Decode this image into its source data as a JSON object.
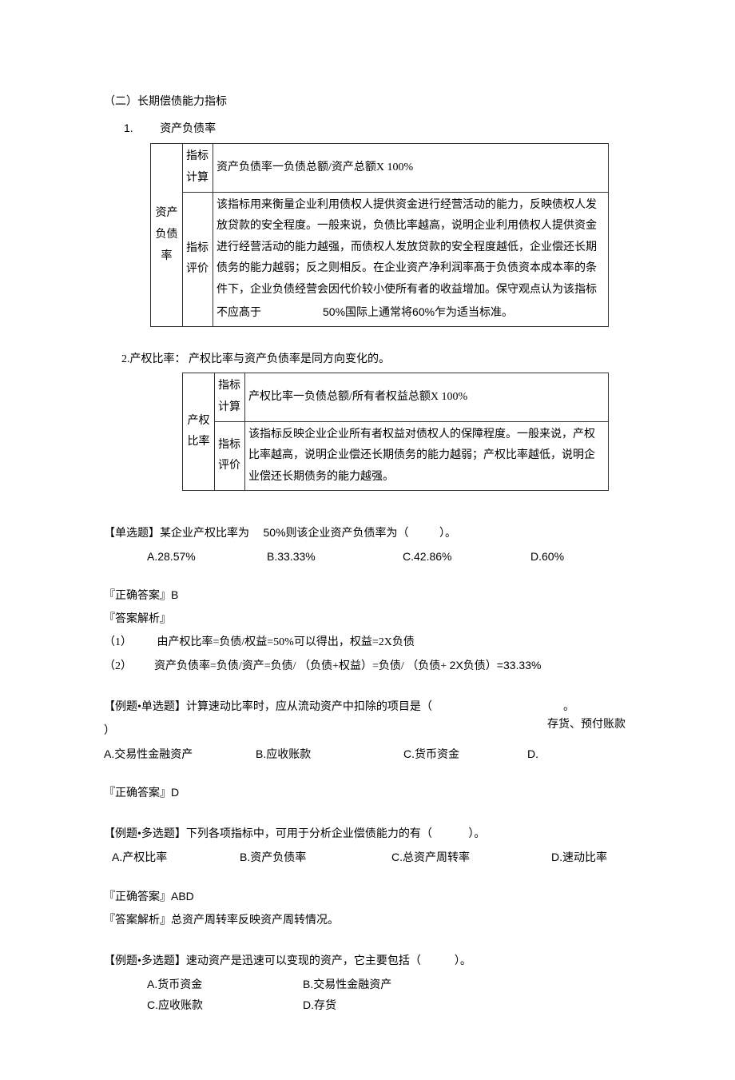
{
  "section": {
    "heading": "（二）长期偿债能力指标",
    "item1": {
      "num": "1.",
      "title": "资产负债率"
    },
    "item2_intro": "2.产权比率： 产权比率与资产负债率是同方向变化的。"
  },
  "table1": {
    "rowlabel": "资产负债率",
    "rows": [
      {
        "label": "指标计算",
        "content": "资产负债率一负债总额/资产总额X 100%"
      },
      {
        "label": "指标评价",
        "content_pre": "该指标用来衡量企业利用债权人提供资金进行经营活动的能力，反映债权人发放贷款的安全程度。一般来说，负债比率越高，说明企业利用债权人提供资金进行经营活动的能力越强，而债权人发放贷款的安全程度越低，企业偿还长期债务的能力越弱；反之则相反。在企业资产净利润率髙于负债资本成本率的条件下，企业负债经营会因代价较小使所有者的收益增加。保守观点认为该指标不应髙于",
        "pct": "50%",
        "content_mid": "国际上通常将",
        "pct2": "60%",
        "content_post": "乍为适当标准。"
      }
    ]
  },
  "table2": {
    "rowlabel": "产权比率",
    "rows": [
      {
        "label": "指标计算",
        "content": "产权比率一负债总额/所有者权益总额X 100%"
      },
      {
        "label": "指标评价",
        "content": "该指标反映企业企业所有者权益对债权人的保障程度。一般来说，产权比率越高，说明企业偿还长期债务的能力越弱；产权比率越低，说明企业偿还长期债务的能力越强。"
      }
    ]
  },
  "q1": {
    "stem_pre": "【单选题】某企业产权比率为",
    "pct": "50%",
    "stem_post": "则该企业资产负债率为（",
    "stem_end": "）。",
    "opts": {
      "a": "A.28.57%",
      "b": "B.33.33%",
      "c": "C.42.86%",
      "d": "D.60%"
    },
    "ans_label": "『正确答案』",
    "ans": "B",
    "analysis_label": "『答案解析』",
    "line1_pre": "（1）",
    "line1": "由产权比率=负债/权益=50%可以得出，权益=2X负债",
    "line2_pre": "（2）",
    "line2a": "资产负债率=负债/资产=负债/ （负债+权益）=负债/ （负债+ ",
    "line2b": "2X",
    "line2c": "负债）",
    "line2d": "=33.33%"
  },
  "q2": {
    "stem": "【例题•单选题】计算速动比率时，应从流动资产中扣除的项目是（",
    "stem_end": "）",
    "trail": "。",
    "opts": {
      "a": "A.交易性金融资产",
      "b": "B.应收账款",
      "c": "C.货币资金",
      "d": "D.",
      "d_text": "存货、预付账款"
    },
    "ans_label": "『正确答案』",
    "ans": "D"
  },
  "q3": {
    "stem": "【例题•多选题】下列各项指标中，可用于分析企业偿债能力的有（",
    "stem_end": "）。",
    "opts": {
      "a": "A.产权比率",
      "b": "B.资产负债率",
      "c": "C.总资产周转率",
      "d": "D.速动比率"
    },
    "ans_label": "『正确答案』",
    "ans": "ABD",
    "analysis": "『答案解析』总资产周转率反映资产周转情况。"
  },
  "q4": {
    "stem": "【例题•多选题】速动资产是迅速可以变现的资产，它主要包括（",
    "stem_end": "）。",
    "opts": {
      "a": "A.货币资金",
      "b": "B.交易性金融资产",
      "c": "C.应收账款",
      "d": "D.存货"
    }
  }
}
